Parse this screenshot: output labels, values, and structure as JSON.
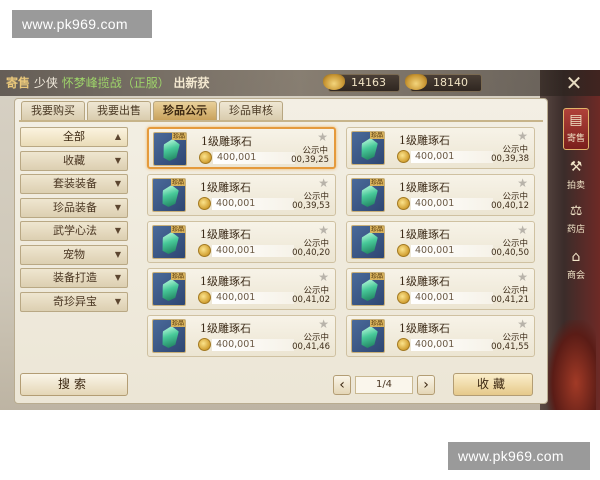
{
  "watermark": {
    "top": "www.pk969.com",
    "bottom": "www.pk969.com"
  },
  "marquee": {
    "part1": "寄售",
    "part2": "少侠",
    "part3": "怀梦峰揽战（正服）",
    "part4": "出新获"
  },
  "currency": {
    "ingot": "14163",
    "gold": "18140"
  },
  "close_icon": "✕",
  "tabs": [
    {
      "label": "我要购买"
    },
    {
      "label": "我要出售"
    },
    {
      "label": "珍品公示",
      "active": true
    },
    {
      "label": "珍品审核"
    }
  ],
  "categories": [
    {
      "label": "全部",
      "arrow": "▲"
    },
    {
      "label": "收藏",
      "arrow": "▼"
    },
    {
      "label": "套装装备",
      "arrow": "▼"
    },
    {
      "label": "珍品装备",
      "arrow": "▼"
    },
    {
      "label": "武学心法",
      "arrow": "▼"
    },
    {
      "label": "宠物",
      "arrow": "▼"
    },
    {
      "label": "装备打造",
      "arrow": "▼"
    },
    {
      "label": "奇珍异宝",
      "arrow": "▼"
    }
  ],
  "items": [
    {
      "name": "1级雕琢石",
      "price": "400,001",
      "status": "公示中",
      "timer": "00,39,25",
      "tag": "珍品"
    },
    {
      "name": "1级雕琢石",
      "price": "400,001",
      "status": "公示中",
      "timer": "00,39,38",
      "tag": "珍品"
    },
    {
      "name": "1级雕琢石",
      "price": "400,001",
      "status": "公示中",
      "timer": "00,39,53",
      "tag": "珍品"
    },
    {
      "name": "1级雕琢石",
      "price": "400,001",
      "status": "公示中",
      "timer": "00,40,12",
      "tag": "珍品"
    },
    {
      "name": "1级雕琢石",
      "price": "400,001",
      "status": "公示中",
      "timer": "00,40,20",
      "tag": "珍品"
    },
    {
      "name": "1级雕琢石",
      "price": "400,001",
      "status": "公示中",
      "timer": "00,40,50",
      "tag": "珍品"
    },
    {
      "name": "1级雕琢石",
      "price": "400,001",
      "status": "公示中",
      "timer": "00,41,02",
      "tag": "珍品"
    },
    {
      "name": "1级雕琢石",
      "price": "400,001",
      "status": "公示中",
      "timer": "00,41,21",
      "tag": "珍品"
    },
    {
      "name": "1级雕琢石",
      "price": "400,001",
      "status": "公示中",
      "timer": "00,41,46",
      "tag": "珍品"
    },
    {
      "name": "1级雕琢石",
      "price": "400,001",
      "status": "公示中",
      "timer": "00,41,55",
      "tag": "珍品"
    }
  ],
  "star_icon": "★",
  "search_label": "搜索",
  "favorite_label": "收藏",
  "pager": {
    "prev": "‹",
    "next": "›",
    "page": "1/4"
  },
  "side_nav": [
    {
      "label": "寄售",
      "icon": "▤"
    },
    {
      "label": "拍卖",
      "icon": "⚒"
    },
    {
      "label": "药店",
      "icon": "⚖"
    },
    {
      "label": "商会",
      "icon": "⌂"
    }
  ]
}
